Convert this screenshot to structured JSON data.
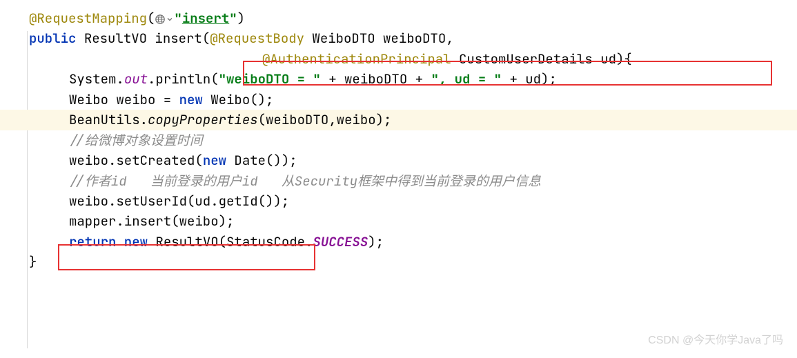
{
  "l1": {
    "anno": "@RequestMapping",
    "p1": "(",
    "str": "\"",
    "strv": "insert",
    "stre": "\"",
    "p2": ")"
  },
  "l2": {
    "kw1": "public",
    "sp1": " ",
    "t1": "ResultVO insert(",
    "anno": "@RequestBody",
    "t2": " WeiboDTO weiboDTO,"
  },
  "l3": {
    "anno": "@AuthenticationPrincipal",
    "t1": " CustomUserDetails ud){"
  },
  "l4": {
    "t1": "System.",
    "fld": "out",
    "t2": ".println(",
    "s1": "\"weiboDTO = \"",
    "t3": " + weiboDTO + ",
    "s2": "\", ud = \"",
    "t4": " + ud);"
  },
  "l5": {
    "t1": "Weibo weibo = ",
    "kw": "new",
    "t2": " Weibo();"
  },
  "l6": {
    "t1": "BeanUtils.",
    "m": "copyProperties",
    "t2": "(weiboDTO,weibo);"
  },
  "l7": {
    "c": "//给微博对象设置时间"
  },
  "l8": {
    "t1": "weibo.setCreated(",
    "kw": "new",
    "t2": " Date());"
  },
  "l9": {
    "c": "//作者id   当前登录的用户id   从Security框架中得到当前登录的用户信息"
  },
  "l10": {
    "t1": "weibo.setUserId(ud.getId());"
  },
  "l11": {
    "t1": "mapper.insert(weibo);"
  },
  "l12": {
    "kw": "return new",
    "t1": " ResultVO(StatusCode.",
    "en": "SUCCESS",
    "t2": ");"
  },
  "l13": {
    "t1": "}"
  },
  "watermark": "CSDN @今天你学Java了吗"
}
